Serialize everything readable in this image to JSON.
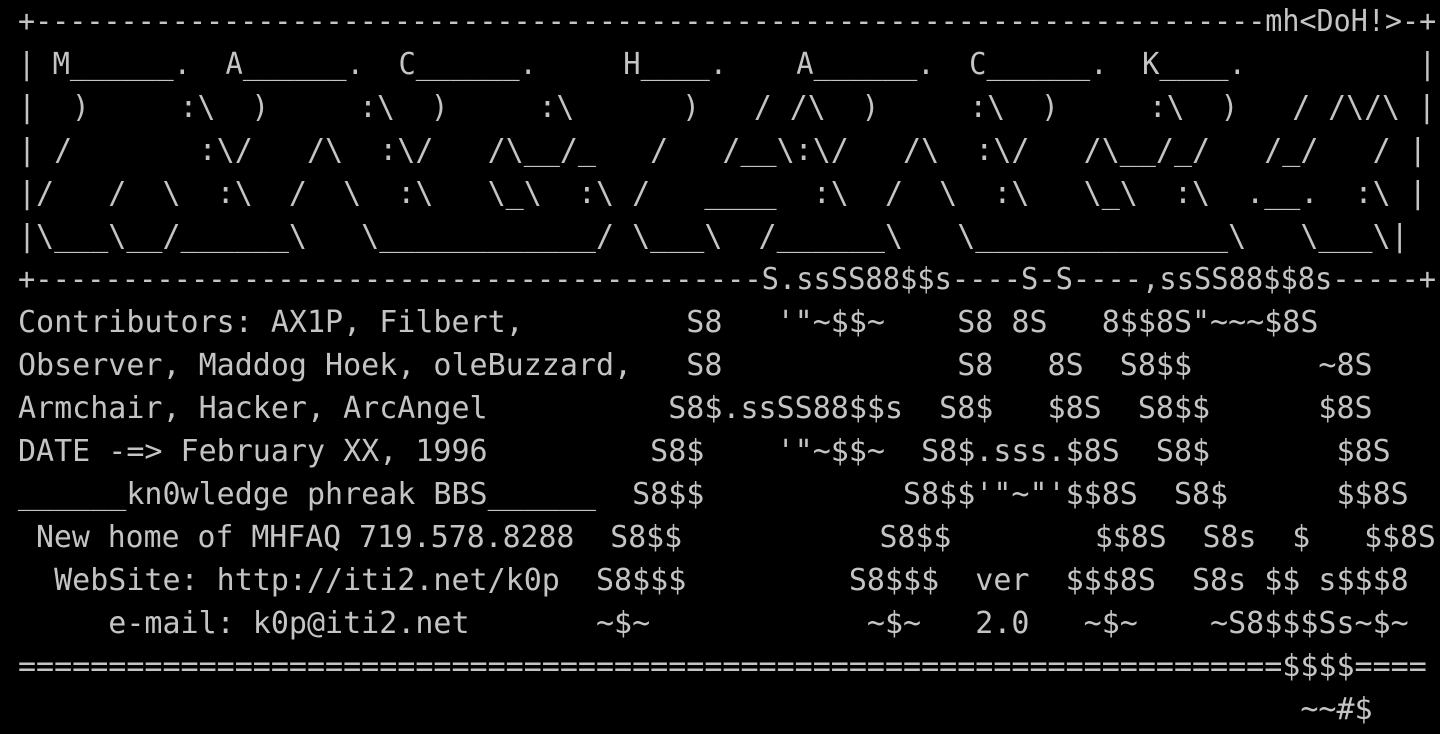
{
  "terminal": {
    "foreground": "#c4c4c4",
    "background": "#000000",
    "lines": [
      "+------------------------------------------------------------------------mh<DoH!>-+",
      "| M______.  A______.  C______.     H____.    A______.  C______.  K____.          |",
      "|  )     :\\  )     :\\  )     :\\      )   / /\\  )     :\\  )     :\\  )   / /\\/\\ |",
      "| /       :\\/   /\\  :\\/   /\\__/_   /   /__\\:\\/   /\\  :\\/   /\\__/_/   /_/   / |",
      "|/   /  \\  :\\  /  \\  :\\   \\_\\  :\\ /   ____  :\\  /  \\  :\\   \\_\\  :\\  .__.  :\\ |",
      "|\\___\\__/______\\   \\____________/ \\___\\  /______\\   \\______________\\   \\___\\|",
      "+------------------------------------------S.ssSS88$$s----S-S----,ssSS88$$8s-----+",
      "Contributors: AX1P, Filbert,         S8   '\"~$$~    S8 8S   8$$8S\"~~~$8S",
      "Observer, Maddog Hoek, oleBuzzard,   S8             S8   8S  S8$$       ~8S",
      "Armchair, Hacker, ArcAngel          S8$.ssSS88$$s  S8$   $8S  S8$$      $8S",
      "DATE -=> February XX, 1996         S8$    '\"~$$~  S8$.sss.$8S  S8$       $8S",
      "______kn0wledge phreak BBS______  S8$$           S8$$'\"~\"'$$8S  S8$      $$8S",
      " New home of MHFAQ 719.578.8288  S8$$           S8$$        $$8S  S8s  $   $$8S",
      "  WebSite: http://iti2.net/k0p  S8$$$         S8$$$  ver  $$$8S  S8s $$ s$$$8",
      "     e-mail: k0p@iti2.net       ~$~            ~$~   2.0   ~$~    ~S8$$$Ss~$~",
      "======================================================================$$$$====",
      "                                                                       ~~#$"
    ]
  }
}
